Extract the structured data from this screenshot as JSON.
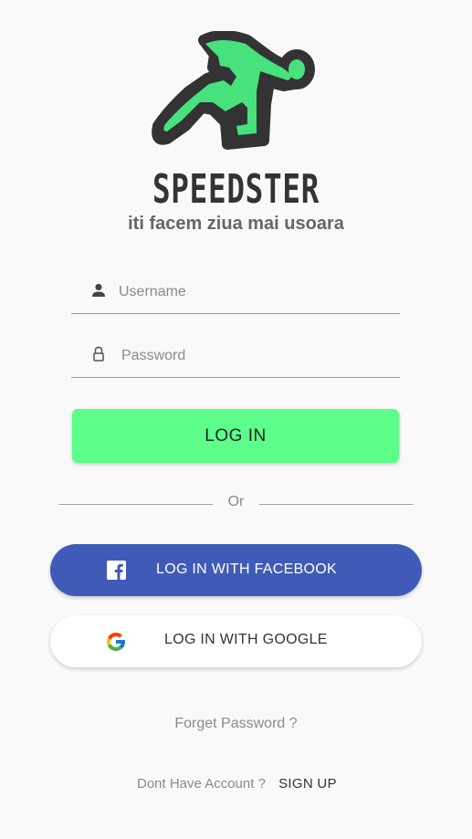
{
  "brand": {
    "logo_icon": "running-man-icon",
    "name": "SPEEDSTER",
    "tagline": "iti facem ziua mai usoara",
    "accent_color": "#5bff8a"
  },
  "form": {
    "username": {
      "icon": "person-icon",
      "placeholder": "Username",
      "value": ""
    },
    "password": {
      "icon": "lock-icon",
      "placeholder": "Password",
      "value": ""
    },
    "login_label": "LOG IN"
  },
  "divider_label": "Or",
  "social": {
    "facebook": {
      "icon": "facebook-icon",
      "label": "LOG IN WITH FACEBOOK",
      "color": "#3f5bb7"
    },
    "google": {
      "icon": "google-icon",
      "label": "LOG IN WITH GOOGLE"
    }
  },
  "footer": {
    "forgot_label": "Forget Password ?",
    "no_account_label": "Dont Have Account ?",
    "signup_label": "SIGN UP"
  }
}
